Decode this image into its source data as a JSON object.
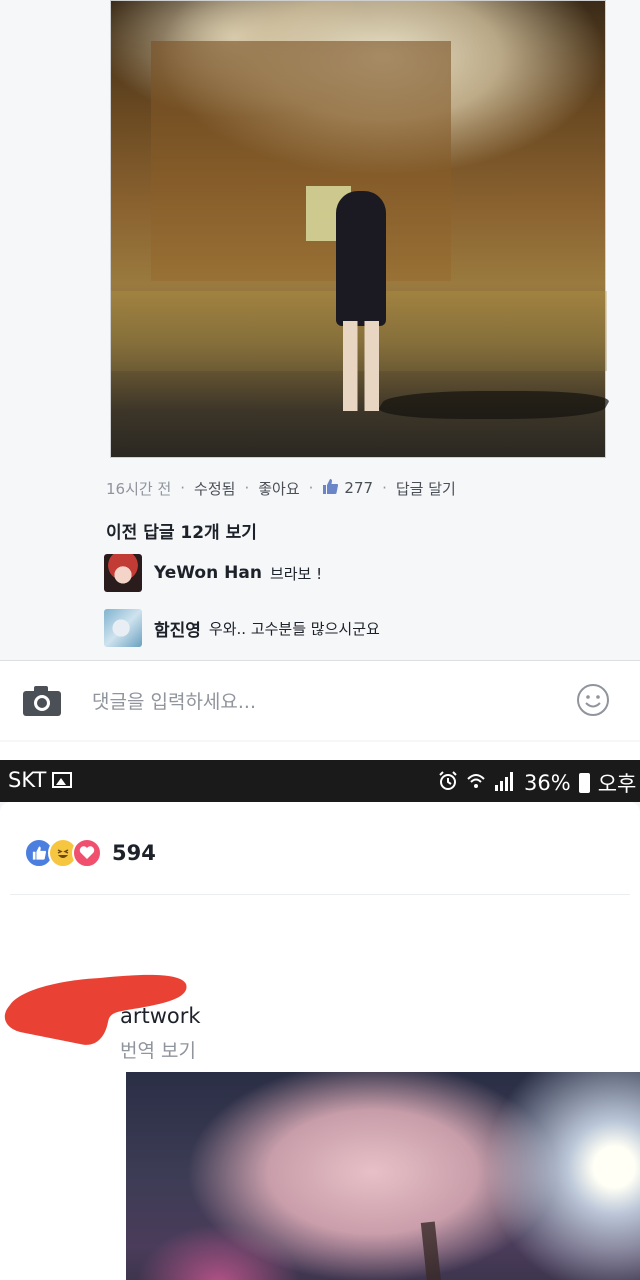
{
  "top": {
    "meta": {
      "time": "16시간 전",
      "edited": "수정됨",
      "like": "좋아요",
      "like_count": "277",
      "reply": "답글 달기"
    },
    "prev_replies": "이전 답글 12개 보기",
    "replies": [
      {
        "name": "YeWon Han",
        "text": "브라보 !"
      },
      {
        "name": "함진영",
        "text": "우와.. 고수분들 많으시군요"
      }
    ],
    "comment_placeholder": "댓글을 입력하세요..."
  },
  "bottom": {
    "status": {
      "carrier": "SKT",
      "battery": "36%",
      "time_partial": "오후"
    },
    "reaction_count": "594",
    "post_title": "artwork",
    "translate": "번역 보기"
  },
  "colors": {
    "accent": "#4a7fe0",
    "meta_text": "#90949c",
    "status_bar": "#1a1a1a"
  },
  "icons": [
    "like-icon",
    "camera-icon",
    "smiley-icon",
    "alarm-icon",
    "wifi-icon",
    "signal-icon",
    "battery-icon",
    "haha-icon",
    "love-icon",
    "gallery-icon"
  ]
}
